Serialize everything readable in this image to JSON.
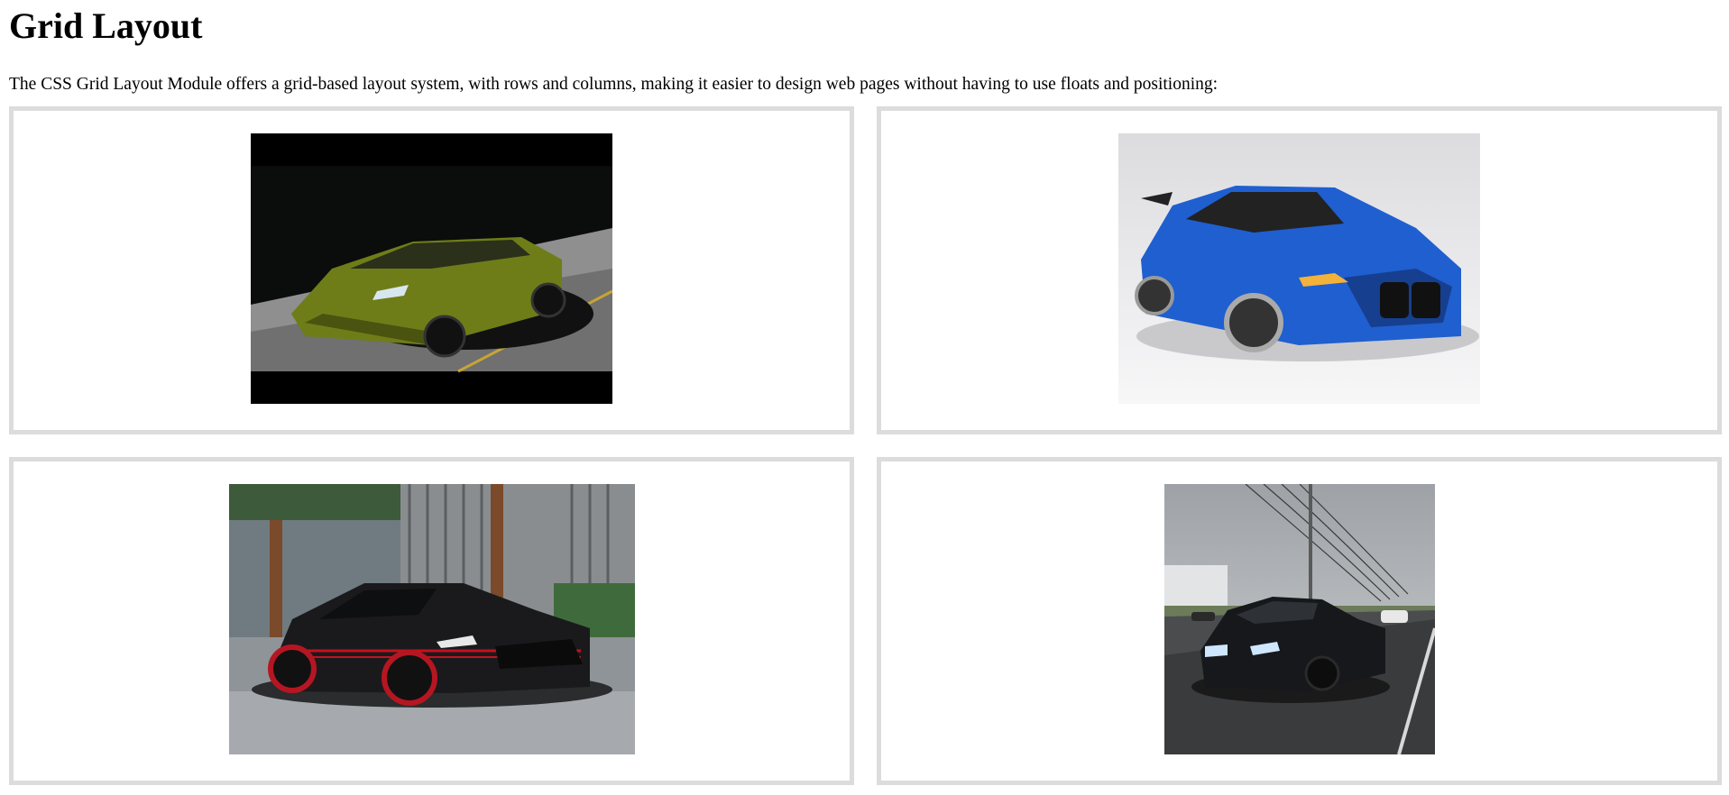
{
  "page": {
    "title": "Grid Layout",
    "intro": "The CSS Grid Layout Module offers a grid-based layout system, with rows and columns, making it easier to design web pages without having to use floats and positioning:"
  },
  "grid": {
    "items": [
      {
        "name": "green-lamborghini-photo",
        "colors": {
          "body": "#7d8c1f",
          "background": "#000000",
          "road": "#9a9a9a"
        }
      },
      {
        "name": "blue-bmw-photo",
        "colors": {
          "body": "#1f5fd0",
          "background": "#e4e4e6"
        }
      },
      {
        "name": "black-mustang-photo",
        "colors": {
          "body": "#1a1a1d",
          "accent": "#c4121f",
          "background": "#7e8a90"
        }
      },
      {
        "name": "black-bmw-m4-photo",
        "colors": {
          "body": "#16181b",
          "background": "#b9bcbf",
          "road": "#4b4c4e"
        }
      }
    ]
  },
  "colors": {
    "cell_border": "#dcdcdc",
    "text": "#000000",
    "background": "#ffffff"
  }
}
